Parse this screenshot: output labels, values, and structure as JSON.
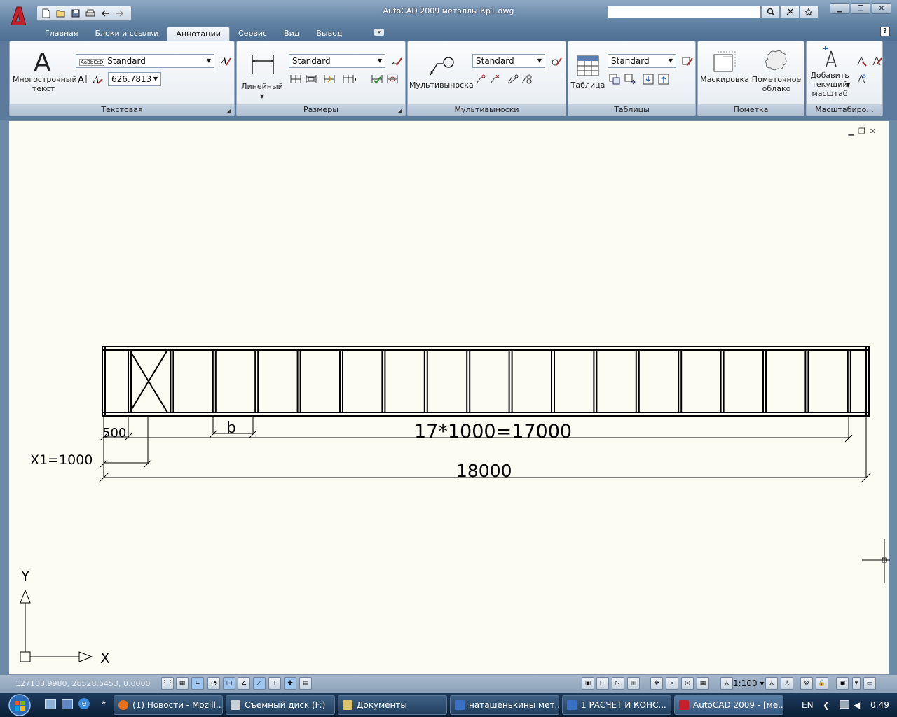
{
  "window": {
    "title": "AutoCAD 2009 металлы Кр1.dwg",
    "controls": [
      "minimize",
      "restore",
      "close"
    ]
  },
  "quick_access": {
    "icons": [
      "new-icon",
      "open-icon",
      "save-icon",
      "print-icon",
      "undo-icon",
      "redo-icon"
    ]
  },
  "tabs": [
    {
      "label": "Главная"
    },
    {
      "label": "Блоки и ссылки"
    },
    {
      "label": "Аннотации",
      "active": true
    },
    {
      "label": "Сервис"
    },
    {
      "label": "Вид"
    },
    {
      "label": "Вывод"
    }
  ],
  "ribbon": {
    "text_panel": {
      "title": "Текстовая",
      "big_label_1": "Многострочный",
      "big_label_2": "текст",
      "style_value": "Standard",
      "style_preview": "AaBbCcD",
      "height_value": "626.7813"
    },
    "dims_panel": {
      "title": "Размеры",
      "big_label": "Линейный",
      "style_value": "Standard"
    },
    "mleader_panel": {
      "title": "Мультивыноски",
      "big_label": "Мультивыноска",
      "style_value": "Standard"
    },
    "tables_panel": {
      "title": "Таблицы",
      "big_label": "Таблица",
      "style_value": "Standard"
    },
    "markup_panel": {
      "title": "Пометка",
      "label_1": "Маскировка",
      "label_2a": "Пометочное",
      "label_2b": "облако"
    },
    "scale_panel": {
      "title": "Масштабиро...",
      "label_a": "Добавить",
      "label_b": "текущий",
      "label_c": "масштаб"
    }
  },
  "drawing": {
    "bay_count": 18,
    "dim_500": "500",
    "dim_b": "b",
    "dim_span": "17*1000=17000",
    "dim_x1": "X1=1000",
    "dim_total": "18000",
    "ucs_x": "X",
    "ucs_y": "Y"
  },
  "status": {
    "coords": "127103.9980, 26528.6453, 0.0000",
    "scale": "1:100"
  },
  "taskbar": {
    "tasks": [
      {
        "label": "(1) Новости - Mozill...",
        "color": "#e8711c"
      },
      {
        "label": "Съемный диск (F:)",
        "color": "#c9cfd6"
      },
      {
        "label": "Документы",
        "color": "#d9c26a"
      },
      {
        "label": "наташенькины мет...",
        "color": "#3a6fc8"
      },
      {
        "label": "1 РАСЧЕТ И КОНС...",
        "color": "#3a6fc8"
      },
      {
        "label": "AutoCAD 2009 - [ме...",
        "color": "#c8202a",
        "active": true
      }
    ],
    "lang": "EN",
    "clock": "0:49"
  },
  "colors": {
    "canvas_bg": "#fdfcf2",
    "accent_red": "#c8202a"
  }
}
